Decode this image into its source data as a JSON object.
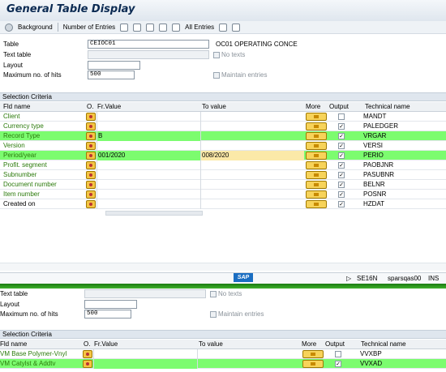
{
  "title": "General Table Display",
  "toolbar": {
    "background": "Background",
    "number_of_entries": "Number of Entries",
    "all_entries": "All Entries"
  },
  "form": {
    "table_label": "Table",
    "table_value": "CEIOC01",
    "table_desc": "OC01 OPERATING CONCE",
    "text_table_label": "Text table",
    "no_texts": "No texts",
    "layout_label": "Layout",
    "max_hits_label": "Maximum no. of hits",
    "max_hits_value": "500",
    "maintain_entries": "Maintain entries"
  },
  "section1": "Selection Criteria",
  "headers": {
    "fld": "Fld name",
    "o": "O.",
    "fr": "Fr.Value",
    "to": "To value",
    "more": "More",
    "output": "Output",
    "tech": "Technical name"
  },
  "rows": [
    {
      "name": "Client",
      "tech": "MANDT",
      "fr": "",
      "to": "",
      "output": false,
      "hl": false
    },
    {
      "name": "Currency type",
      "tech": "PALEDGER",
      "fr": "",
      "to": "",
      "output": true,
      "hl": false
    },
    {
      "name": "Record Type",
      "tech": "VRGAR",
      "fr": "B",
      "to": "",
      "output": true,
      "hl": true
    },
    {
      "name": "Version",
      "tech": "VERSI",
      "fr": "",
      "to": "",
      "output": true,
      "hl": false
    },
    {
      "name": "Period/year",
      "tech": "PERIO",
      "fr": "001/2020",
      "to": "008/2020",
      "output": true,
      "hl": true
    },
    {
      "name": "Profit. segment",
      "tech": "PAOBJNR",
      "fr": "",
      "to": "",
      "output": true,
      "hl": false
    },
    {
      "name": "Subnumber",
      "tech": "PASUBNR",
      "fr": "",
      "to": "",
      "output": true,
      "hl": false
    },
    {
      "name": "Document number",
      "tech": "BELNR",
      "fr": "",
      "to": "",
      "output": true,
      "hl": false
    },
    {
      "name": "Item number",
      "tech": "POSNR",
      "fr": "",
      "to": "",
      "output": true,
      "hl": false
    },
    {
      "name": "Created on",
      "tech": "HZDAT",
      "fr": "",
      "to": "",
      "output": true,
      "hl": false
    }
  ],
  "status": {
    "sap": "SAP",
    "tcode": "SE16N",
    "server": "sparsqas00",
    "mode": "INS"
  },
  "lower": {
    "text_table_label": "Text table",
    "no_texts": "No texts",
    "layout_label": "Layout",
    "max_hits_label": "Maximum no. of hits",
    "max_hits_value": "500",
    "maintain_entries": "Maintain entries",
    "section": "Selection Criteria",
    "headers": {
      "fld": "Fld name",
      "o": "O.",
      "fr": "Fr.Value",
      "to": "To value",
      "more": "More",
      "output": "Output",
      "tech": "Technical name"
    },
    "rows": [
      {
        "name": "VM Base Polymer-Vnyl",
        "tech": "VVXBP",
        "output": false,
        "hl": false
      },
      {
        "name": "VM Catylst & Addtv",
        "tech": "VVXAD",
        "output": true,
        "hl": true
      }
    ]
  }
}
